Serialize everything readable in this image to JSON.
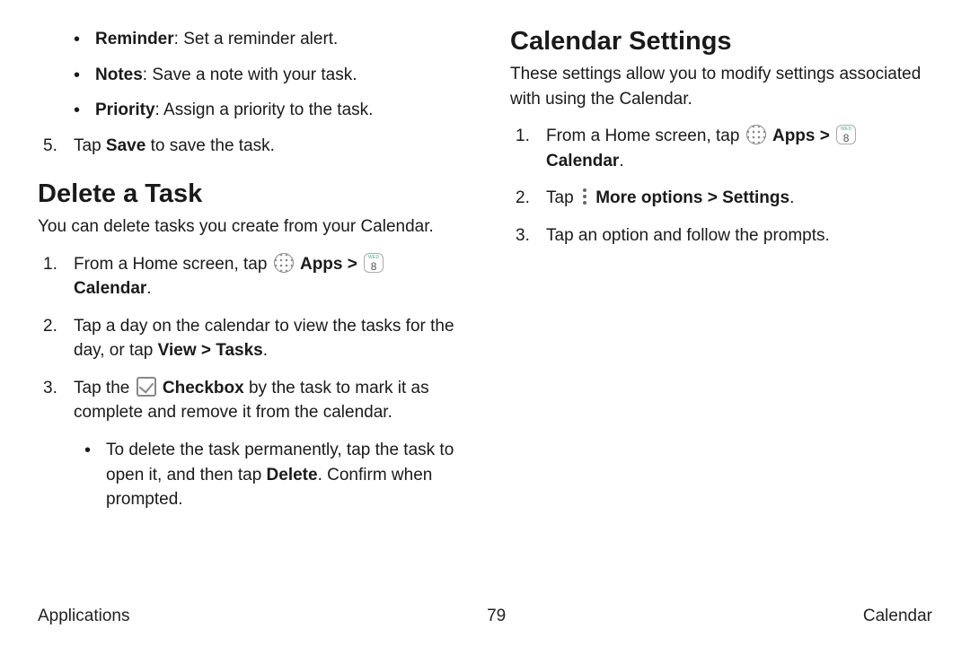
{
  "left": {
    "bullets": [
      {
        "bold": "Reminder",
        "rest": ": Set a reminder alert."
      },
      {
        "bold": "Notes",
        "rest": ": Save a note with your task."
      },
      {
        "bold": "Priority",
        "rest": ": Assign a priority to the task."
      }
    ],
    "step5": {
      "num": "5.",
      "pre": "Tap ",
      "bold": "Save",
      "post": " to save the task."
    },
    "heading": "Delete a Task",
    "intro": "You can delete tasks you create from your Calendar.",
    "steps": {
      "s1": {
        "num": "1.",
        "pre": "From a Home screen, tap ",
        "apps": "Apps",
        "sep": " > ",
        "cal": "Calendar",
        "end": "."
      },
      "s2": {
        "num": "2.",
        "pre": "Tap a day on the calendar to view the tasks for the day, or tap ",
        "bold": "View > Tasks",
        "end": "."
      },
      "s3": {
        "num": "3.",
        "pre": "Tap the ",
        "bold": "Checkbox",
        "post": " by the task to mark it as complete and remove it from the calendar."
      },
      "s3sub": {
        "pre": "To delete the task permanently, tap the task to open it, and then tap ",
        "bold": "Delete",
        "post": ". Confirm when prompted."
      }
    }
  },
  "right": {
    "heading": "Calendar Settings",
    "intro": "These settings allow you to modify settings associated with using the Calendar.",
    "steps": {
      "s1": {
        "num": "1.",
        "pre": "From a Home screen, tap ",
        "apps": "Apps",
        "sep": " > ",
        "cal": "Calendar",
        "end": "."
      },
      "s2": {
        "num": "2.",
        "pre": "Tap ",
        "bold": "More options > Settings",
        "end": "."
      },
      "s3": {
        "num": "3.",
        "text": "Tap an option and follow the prompts."
      }
    }
  },
  "footer": {
    "left": "Applications",
    "center": "79",
    "right": "Calendar"
  }
}
